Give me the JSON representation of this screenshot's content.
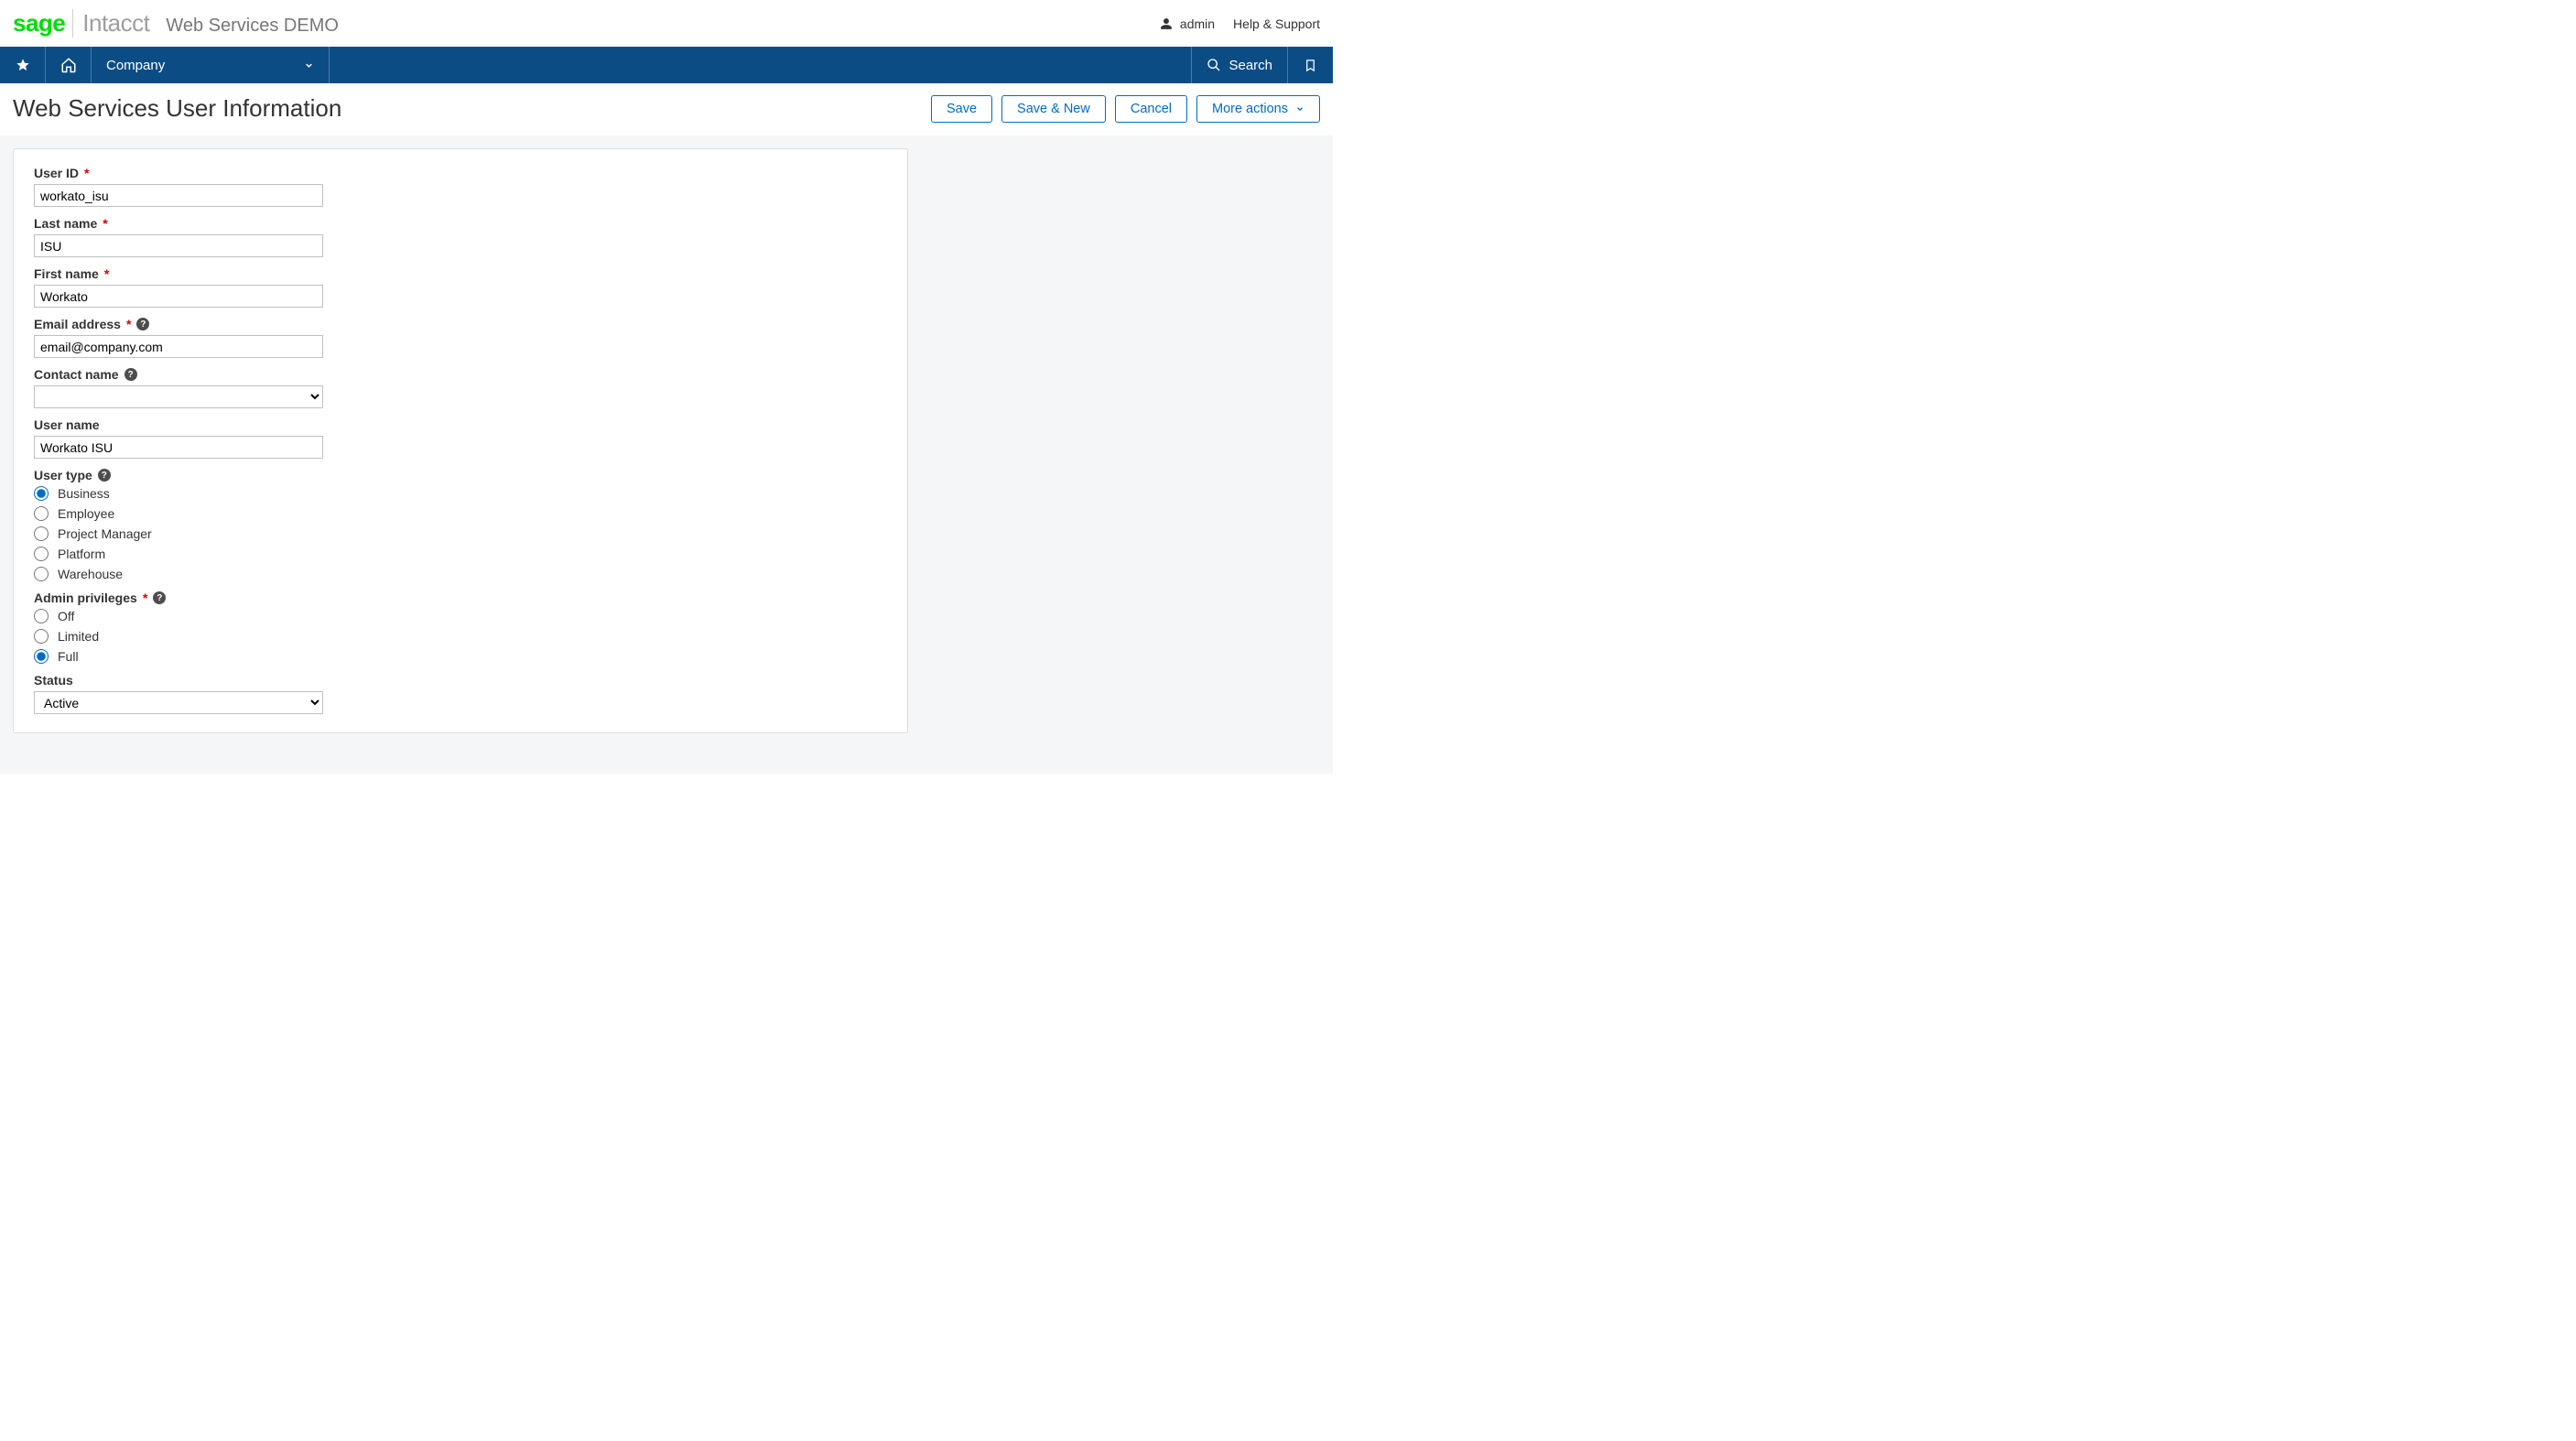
{
  "header": {
    "brand_sage": "sage",
    "brand_intacct": "Intacct",
    "tenant": "Web Services DEMO",
    "user_label": "admin",
    "help_label": "Help & Support"
  },
  "nav": {
    "module_label": "Company",
    "search_label": "Search"
  },
  "page": {
    "title": "Web Services User Information"
  },
  "actions": {
    "save": "Save",
    "save_new": "Save & New",
    "cancel": "Cancel",
    "more": "More actions"
  },
  "form": {
    "user_id": {
      "label": "User ID",
      "value": "workato_isu",
      "required": true
    },
    "last_name": {
      "label": "Last name",
      "value": "ISU",
      "required": true
    },
    "first_name": {
      "label": "First name",
      "value": "Workato",
      "required": true
    },
    "email": {
      "label": "Email address",
      "value": "email@company.com",
      "required": true,
      "help": true
    },
    "contact_name": {
      "label": "Contact name",
      "value": "",
      "help": true
    },
    "user_name": {
      "label": "User name",
      "value": "Workato ISU"
    },
    "user_type": {
      "label": "User type",
      "help": true,
      "selected": "Business",
      "options": [
        "Business",
        "Employee",
        "Project Manager",
        "Platform",
        "Warehouse"
      ]
    },
    "admin_priv": {
      "label": "Admin privileges",
      "required": true,
      "help": true,
      "selected": "Full",
      "options": [
        "Off",
        "Limited",
        "Full"
      ]
    },
    "status": {
      "label": "Status",
      "value": "Active"
    }
  }
}
